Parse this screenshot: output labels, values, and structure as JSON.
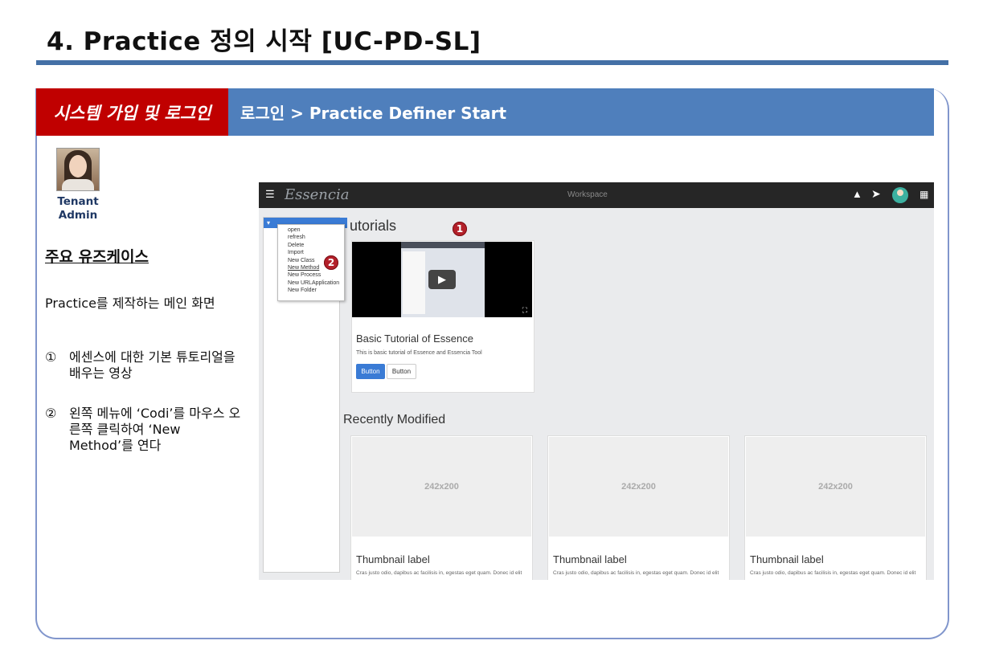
{
  "slide": {
    "title": "4. Practice 정의 시작 [UC-PD-SL]",
    "banner_red": "시스템 가입 및 로그인",
    "banner_path": "로그인  > Practice Definer Start"
  },
  "left_panel": {
    "role": "Tenant Admin",
    "usecase_heading": "주요 유즈케이스",
    "description": "Practice를 제작하는 메인 화면",
    "steps": [
      {
        "num": "①",
        "text": "에센스에 대한 기본 튜토리얼을 배우는 영상"
      },
      {
        "num": "②",
        "text": "왼쪽 메뉴에 ‘Codi’를 마우스 오른쪽 클릭하여 ‘New Method’를 연다"
      }
    ]
  },
  "app": {
    "brand": "Essencia",
    "center_title": "Workspace",
    "icons": {
      "menu": "hamburger-icon",
      "bell": "bell-icon",
      "send": "send-icon",
      "avatar": "user-avatar",
      "apps": "apps-grid-icon"
    },
    "context_menu": [
      "open",
      "refresh",
      "Delete",
      "Import",
      "New Class",
      "New Method",
      "New Process",
      "New URLApplication",
      "New Folder"
    ],
    "tutorials_title": "utorials",
    "tutorial_card": {
      "title": "Basic Tutorial of Essence",
      "subtitle": "This is basic tutorial of Essence and Essencia Tool",
      "primary_button": "Button",
      "secondary_button": "Button"
    },
    "recent_title": "Recently Modified",
    "thumbnails": [
      {
        "placeholder": "242x200",
        "label": "Thumbnail label",
        "text": "Cras justo odio, dapibus ac facilisis in, egestas eget quam. Donec id elit"
      },
      {
        "placeholder": "242x200",
        "label": "Thumbnail label",
        "text": "Cras justo odio, dapibus ac facilisis in, egestas eget quam. Donec id elit"
      },
      {
        "placeholder": "242x200",
        "label": "Thumbnail label",
        "text": "Cras justo odio, dapibus ac facilisis in, egestas eget quam. Donec id elit"
      }
    ],
    "badges": [
      "1",
      "2"
    ]
  },
  "colors": {
    "title_rule": "#4470a6",
    "banner_blue": "#4f7fbc",
    "banner_red": "#c00000",
    "badge": "#b3202a",
    "primary_button": "#3a7bd5"
  }
}
